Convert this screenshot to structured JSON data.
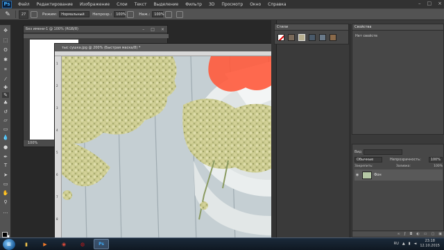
{
  "app": {
    "logo": "Ps"
  },
  "menu": [
    "Файл",
    "Редактирование",
    "Изображение",
    "Слои",
    "Текст",
    "Выделение",
    "Фильтр",
    "3D",
    "Просмотр",
    "Окно",
    "Справка"
  ],
  "window_controls": [
    "–",
    "□",
    "×"
  ],
  "options": {
    "brush_size": "27",
    "mode_label": "Режим:",
    "mode_value": "Нормальный",
    "opacity_label": "Непрозр.:",
    "opacity_value": "100%",
    "pressure_label": "Наж.:",
    "pressure_value": "100%"
  },
  "tools": [
    "move-icon",
    "marquee-icon",
    "lasso-icon",
    "quick-select-icon",
    "crop-icon",
    "eyedropper-icon",
    "healing-icon",
    "brush-icon",
    "stamp-icon",
    "history-brush-icon",
    "eraser-icon",
    "gradient-icon",
    "blur-icon",
    "dodge-icon",
    "pen-icon",
    "type-icon",
    "path-select-icon",
    "shape-icon",
    "hand-icon",
    "zoom-icon",
    "edit-toolbar-icon"
  ],
  "doc1": {
    "title": "Без имени-1 @ 100% (RGB/8)",
    "zoom": "100%"
  },
  "doc2": {
    "title": "тыс сушка.jpg @ 200% (Быстрая маска/8) *",
    "ruler_numbers": [
      "1",
      "2",
      "3",
      "4",
      "5",
      "6",
      "7",
      "8"
    ]
  },
  "panels": {
    "styles_tab": "Стили",
    "properties_tab": "Свойства",
    "properties_text": "Нет свойств",
    "layers": {
      "search_label": "Вид",
      "blend_mode": "Обычные",
      "opacity_label": "Непрозрачность:",
      "opacity_value": "100%",
      "lock_label": "Закрепить:",
      "fill_label": "Заливка:",
      "fill_value": "100%",
      "layer_name": "Фон"
    }
  },
  "taskbar": {
    "time": "23:18",
    "date": "12.10.2015",
    "lang": "RU"
  },
  "colors": {
    "accent_blue": "#3fa9f5",
    "mask_red": "#ff5a3c"
  }
}
